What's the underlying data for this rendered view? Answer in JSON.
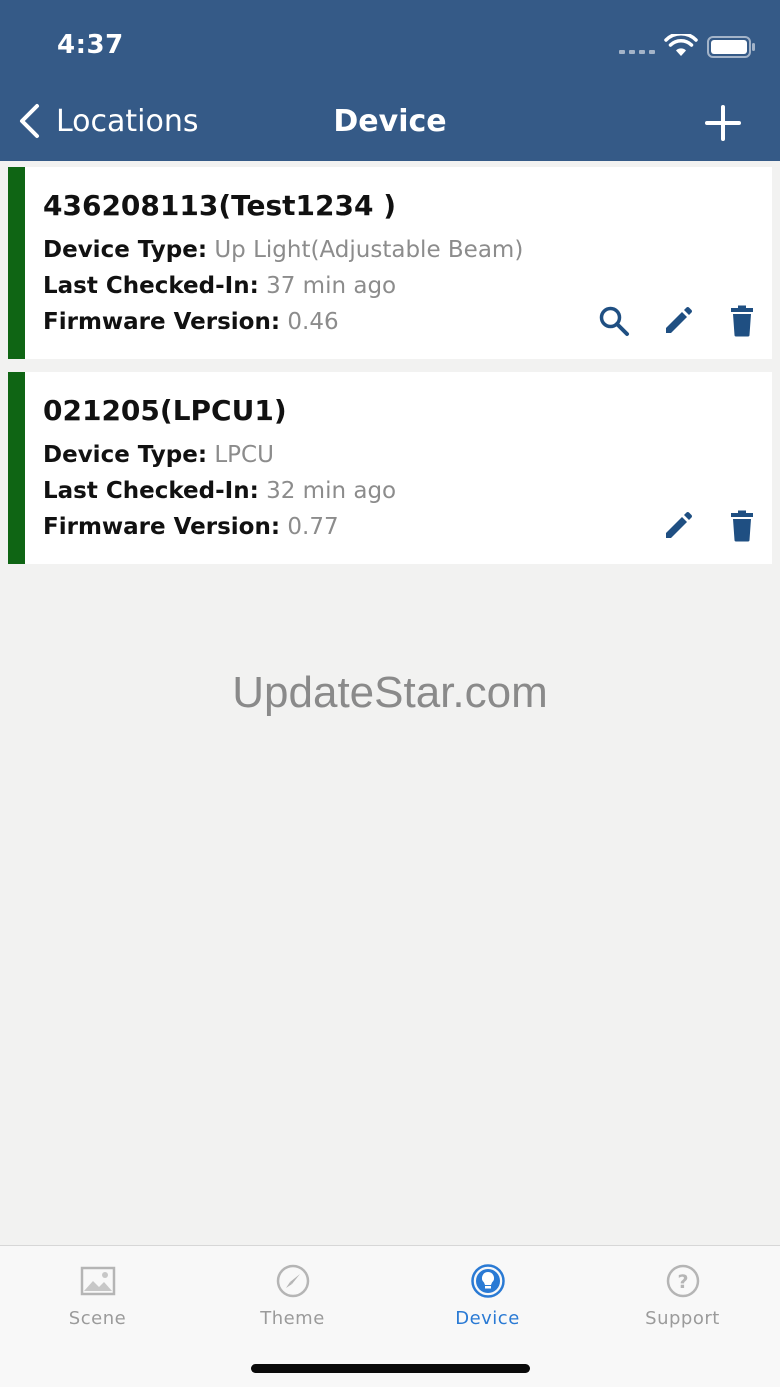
{
  "status_bar": {
    "time": "4:37"
  },
  "nav": {
    "back_label": "Locations",
    "title": "Device"
  },
  "colors": {
    "header": "#355a87",
    "status_bar_green": "#0f6514",
    "active_tab": "#2a7ad4",
    "icon_blue": "#1f4f82"
  },
  "devices": [
    {
      "title": "436208113(Test1234 )",
      "device_type_label": "Device Type:",
      "device_type": "Up Light(Adjustable Beam)",
      "last_checked_label": "Last Checked-In:",
      "last_checked": "37 min ago",
      "firmware_label": "Firmware Version:",
      "firmware": "0.46",
      "actions": [
        "search-icon",
        "edit-icon",
        "trash-icon"
      ]
    },
    {
      "title": "021205(LPCU1)",
      "device_type_label": "Device Type:",
      "device_type": "LPCU",
      "last_checked_label": "Last Checked-In:",
      "last_checked": "32 min ago",
      "firmware_label": "Firmware Version:",
      "firmware": "0.77",
      "actions": [
        "edit-icon",
        "trash-icon"
      ]
    }
  ],
  "watermark": "UpdateStar.com",
  "tabs": [
    {
      "label": "Scene",
      "icon": "image-icon",
      "active": false
    },
    {
      "label": "Theme",
      "icon": "compass-icon",
      "active": false
    },
    {
      "label": "Device",
      "icon": "bulb-icon",
      "active": true
    },
    {
      "label": "Support",
      "icon": "help-icon",
      "active": false
    }
  ]
}
